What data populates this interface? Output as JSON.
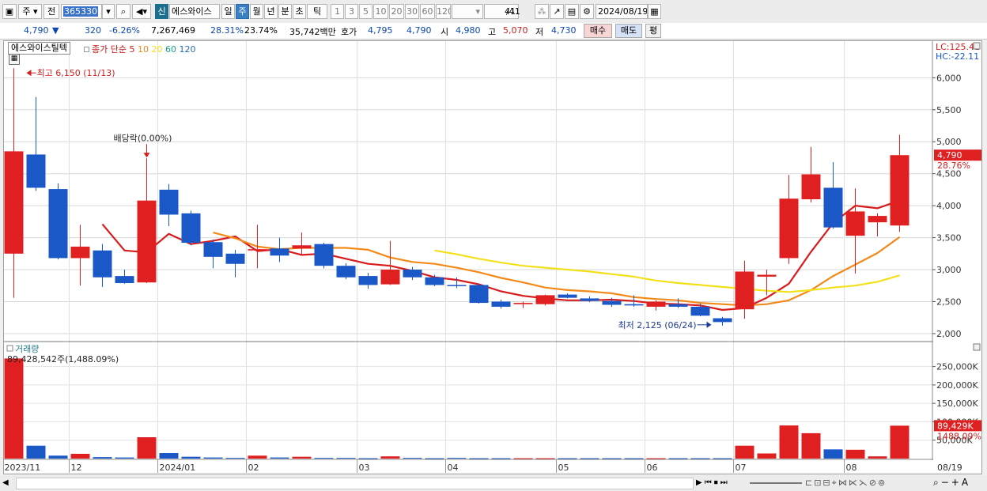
{
  "toolbar": {
    "period_type": "주",
    "prev_label": "전",
    "code": "365330",
    "new_badge": "신",
    "stock_name": "에스와이스",
    "periods": [
      "일",
      "주",
      "월",
      "년",
      "분",
      "초",
      "틱"
    ],
    "selected_period": "주",
    "numbers": [
      "1",
      "3",
      "5",
      "10",
      "20",
      "30",
      "60",
      "120"
    ],
    "page_count": "41",
    "page_total": "/41",
    "date": "2024/08/19"
  },
  "quote": {
    "price": "4,790",
    "direction": "▼",
    "change": "320",
    "change_pct": "-6.26%",
    "volume": "7,267,469",
    "vol_ratio": "28.31%",
    "turnover": "23.74%",
    "amount": "35,742백만",
    "bid_label": "호가",
    "bid_ask": "4,795",
    "bid_bid": "4,790",
    "open_label": "시",
    "open": "4,980",
    "high_label": "고",
    "high": "5,070",
    "low_label": "저",
    "low": "4,730",
    "buy_label": "매수",
    "sell_label": "매도",
    "eval_label": "평"
  },
  "chart_data": {
    "type": "candlestick",
    "title": "에스와이스틸텍",
    "legend_prefix": "종가 단순",
    "ma_periods": [
      "5",
      "10",
      "20",
      "60",
      "120"
    ],
    "ma_colors": [
      "#d81b1b",
      "#f28a1a",
      "#f2e11a",
      "#17a08c",
      "#2a6bb8"
    ],
    "up_color": "#e02020",
    "down_color": "#1a57c7",
    "ylim": [
      1900,
      6400
    ],
    "yticks": [
      2000,
      2500,
      3000,
      3500,
      4000,
      4500,
      5000,
      5500,
      6000
    ],
    "ytick_labels": [
      "2,000",
      "2,500",
      "3,000",
      "3,500",
      "4,000",
      "4,500",
      "5,000",
      "5,500",
      "6,000"
    ],
    "candles": [
      {
        "o": 3250,
        "h": 6150,
        "l": 2560,
        "c": 4850
      },
      {
        "o": 4800,
        "h": 5700,
        "l": 4230,
        "c": 4280
      },
      {
        "o": 4260,
        "h": 4350,
        "l": 3160,
        "c": 3180
      },
      {
        "o": 3180,
        "h": 3700,
        "l": 2750,
        "c": 3360
      },
      {
        "o": 3300,
        "h": 3400,
        "l": 2730,
        "c": 2880
      },
      {
        "o": 2900,
        "h": 3000,
        "l": 2780,
        "c": 2790
      },
      {
        "o": 2800,
        "h": 4740,
        "l": 2790,
        "c": 4080
      },
      {
        "o": 4250,
        "h": 4340,
        "l": 3680,
        "c": 3860
      },
      {
        "o": 3880,
        "h": 3920,
        "l": 3380,
        "c": 3420
      },
      {
        "o": 3430,
        "h": 3470,
        "l": 3020,
        "c": 3200
      },
      {
        "o": 3250,
        "h": 3310,
        "l": 2880,
        "c": 3090
      },
      {
        "o": 3300,
        "h": 3700,
        "l": 3020,
        "c": 3320
      },
      {
        "o": 3330,
        "h": 3500,
        "l": 3120,
        "c": 3220
      },
      {
        "o": 3330,
        "h": 3580,
        "l": 3230,
        "c": 3380
      },
      {
        "o": 3400,
        "h": 3420,
        "l": 3020,
        "c": 3060
      },
      {
        "o": 3060,
        "h": 3100,
        "l": 2850,
        "c": 2880
      },
      {
        "o": 2900,
        "h": 2950,
        "l": 2700,
        "c": 2760
      },
      {
        "o": 2770,
        "h": 3450,
        "l": 2760,
        "c": 3000
      },
      {
        "o": 3000,
        "h": 3040,
        "l": 2840,
        "c": 2880
      },
      {
        "o": 2880,
        "h": 2920,
        "l": 2740,
        "c": 2760
      },
      {
        "o": 2760,
        "h": 2880,
        "l": 2710,
        "c": 2750
      },
      {
        "o": 2760,
        "h": 2780,
        "l": 2470,
        "c": 2480
      },
      {
        "o": 2500,
        "h": 2530,
        "l": 2390,
        "c": 2420
      },
      {
        "o": 2460,
        "h": 2500,
        "l": 2400,
        "c": 2480
      },
      {
        "o": 2460,
        "h": 2610,
        "l": 2440,
        "c": 2600
      },
      {
        "o": 2610,
        "h": 2630,
        "l": 2550,
        "c": 2560
      },
      {
        "o": 2550,
        "h": 2580,
        "l": 2490,
        "c": 2510
      },
      {
        "o": 2510,
        "h": 2560,
        "l": 2420,
        "c": 2450
      },
      {
        "o": 2460,
        "h": 2600,
        "l": 2420,
        "c": 2440
      },
      {
        "o": 2420,
        "h": 2520,
        "l": 2360,
        "c": 2500
      },
      {
        "o": 2460,
        "h": 2550,
        "l": 2400,
        "c": 2420
      },
      {
        "o": 2420,
        "h": 2470,
        "l": 2270,
        "c": 2280
      },
      {
        "o": 2240,
        "h": 2260,
        "l": 2125,
        "c": 2180
      },
      {
        "o": 2380,
        "h": 3140,
        "l": 2230,
        "c": 2970
      },
      {
        "o": 2890,
        "h": 3000,
        "l": 2600,
        "c": 2920
      },
      {
        "o": 3180,
        "h": 4480,
        "l": 3090,
        "c": 4110
      },
      {
        "o": 4100,
        "h": 4920,
        "l": 4050,
        "c": 4490
      },
      {
        "o": 4280,
        "h": 4680,
        "l": 3640,
        "c": 3660
      },
      {
        "o": 3530,
        "h": 4270,
        "l": 2940,
        "c": 3910
      },
      {
        "o": 3740,
        "h": 3880,
        "l": 3520,
        "c": 3840
      },
      {
        "o": 3690,
        "h": 5110,
        "l": 3590,
        "c": 4790
      }
    ],
    "ma5": [
      null,
      null,
      null,
      null,
      3710,
      3300,
      3270,
      3560,
      3400,
      3450,
      3520,
      3290,
      3320,
      3230,
      3250,
      3170,
      3090,
      3060,
      2980,
      2880,
      2840,
      2770,
      2660,
      2590,
      2550,
      2520,
      2520,
      2530,
      2510,
      2470,
      2460,
      2440,
      2370,
      2400,
      2560,
      2780,
      3280,
      3730,
      4000,
      3960,
      4080
    ],
    "ma10": [
      null,
      null,
      null,
      null,
      null,
      null,
      null,
      null,
      null,
      3580,
      3490,
      3360,
      3320,
      3340,
      3340,
      3340,
      3310,
      3190,
      3120,
      3090,
      3030,
      2960,
      2870,
      2800,
      2720,
      2680,
      2660,
      2630,
      2570,
      2540,
      2520,
      2480,
      2460,
      2440,
      2460,
      2520,
      2680,
      2900,
      3080,
      3260,
      3510
    ],
    "ma20": [
      null,
      null,
      null,
      null,
      null,
      null,
      null,
      null,
      null,
      null,
      null,
      null,
      null,
      null,
      null,
      null,
      null,
      null,
      null,
      3300,
      3240,
      3170,
      3110,
      3060,
      3030,
      3000,
      2970,
      2930,
      2890,
      2830,
      2790,
      2760,
      2730,
      2700,
      2670,
      2650,
      2680,
      2720,
      2750,
      2810,
      2910,
      3000
    ],
    "volume_label": "거래량",
    "volume_info": "89,428,542주(1,488.09%)",
    "volume_ylim": [
      0,
      290000
    ],
    "volume_yticks": [
      50000,
      100000,
      150000,
      200000,
      250000
    ],
    "volume_ytick_labels": [
      "50,000K",
      "100,000K",
      "150,000K",
      "200,000K",
      "250,000K"
    ],
    "volumes": [
      272000,
      35000,
      8000,
      13000,
      4000,
      3000,
      58000,
      15000,
      5000,
      3000,
      2000,
      8000,
      3000,
      5000,
      2000,
      2000,
      1000,
      6000,
      2000,
      1000,
      2000,
      1000,
      1000,
      1000,
      1000,
      1000,
      1000,
      1000,
      1000,
      1000,
      1000,
      1000,
      1000,
      35000,
      14000,
      90000,
      69000,
      25000,
      24000,
      6000,
      89429
    ],
    "x_labels": [
      "2023/11",
      "12",
      "2024/01",
      "02",
      "03",
      "04",
      "05",
      "06",
      "07",
      "08"
    ],
    "x_label_positions": [
      0,
      3,
      7,
      11,
      16,
      20,
      25,
      29,
      33,
      38
    ],
    "x_end_label": "08/19",
    "annotations": {
      "high": "최고 6,150 (11/13)",
      "low": "최저 2,125 (06/24)",
      "dividend": "배당락(0.00%)",
      "lc": "LC:125.41",
      "hc": "HC:-22.11",
      "last_price": "4,790",
      "last_pct": "28.76%",
      "last_volume": "89,429K",
      "last_vol_pct": "1488.09%"
    }
  }
}
